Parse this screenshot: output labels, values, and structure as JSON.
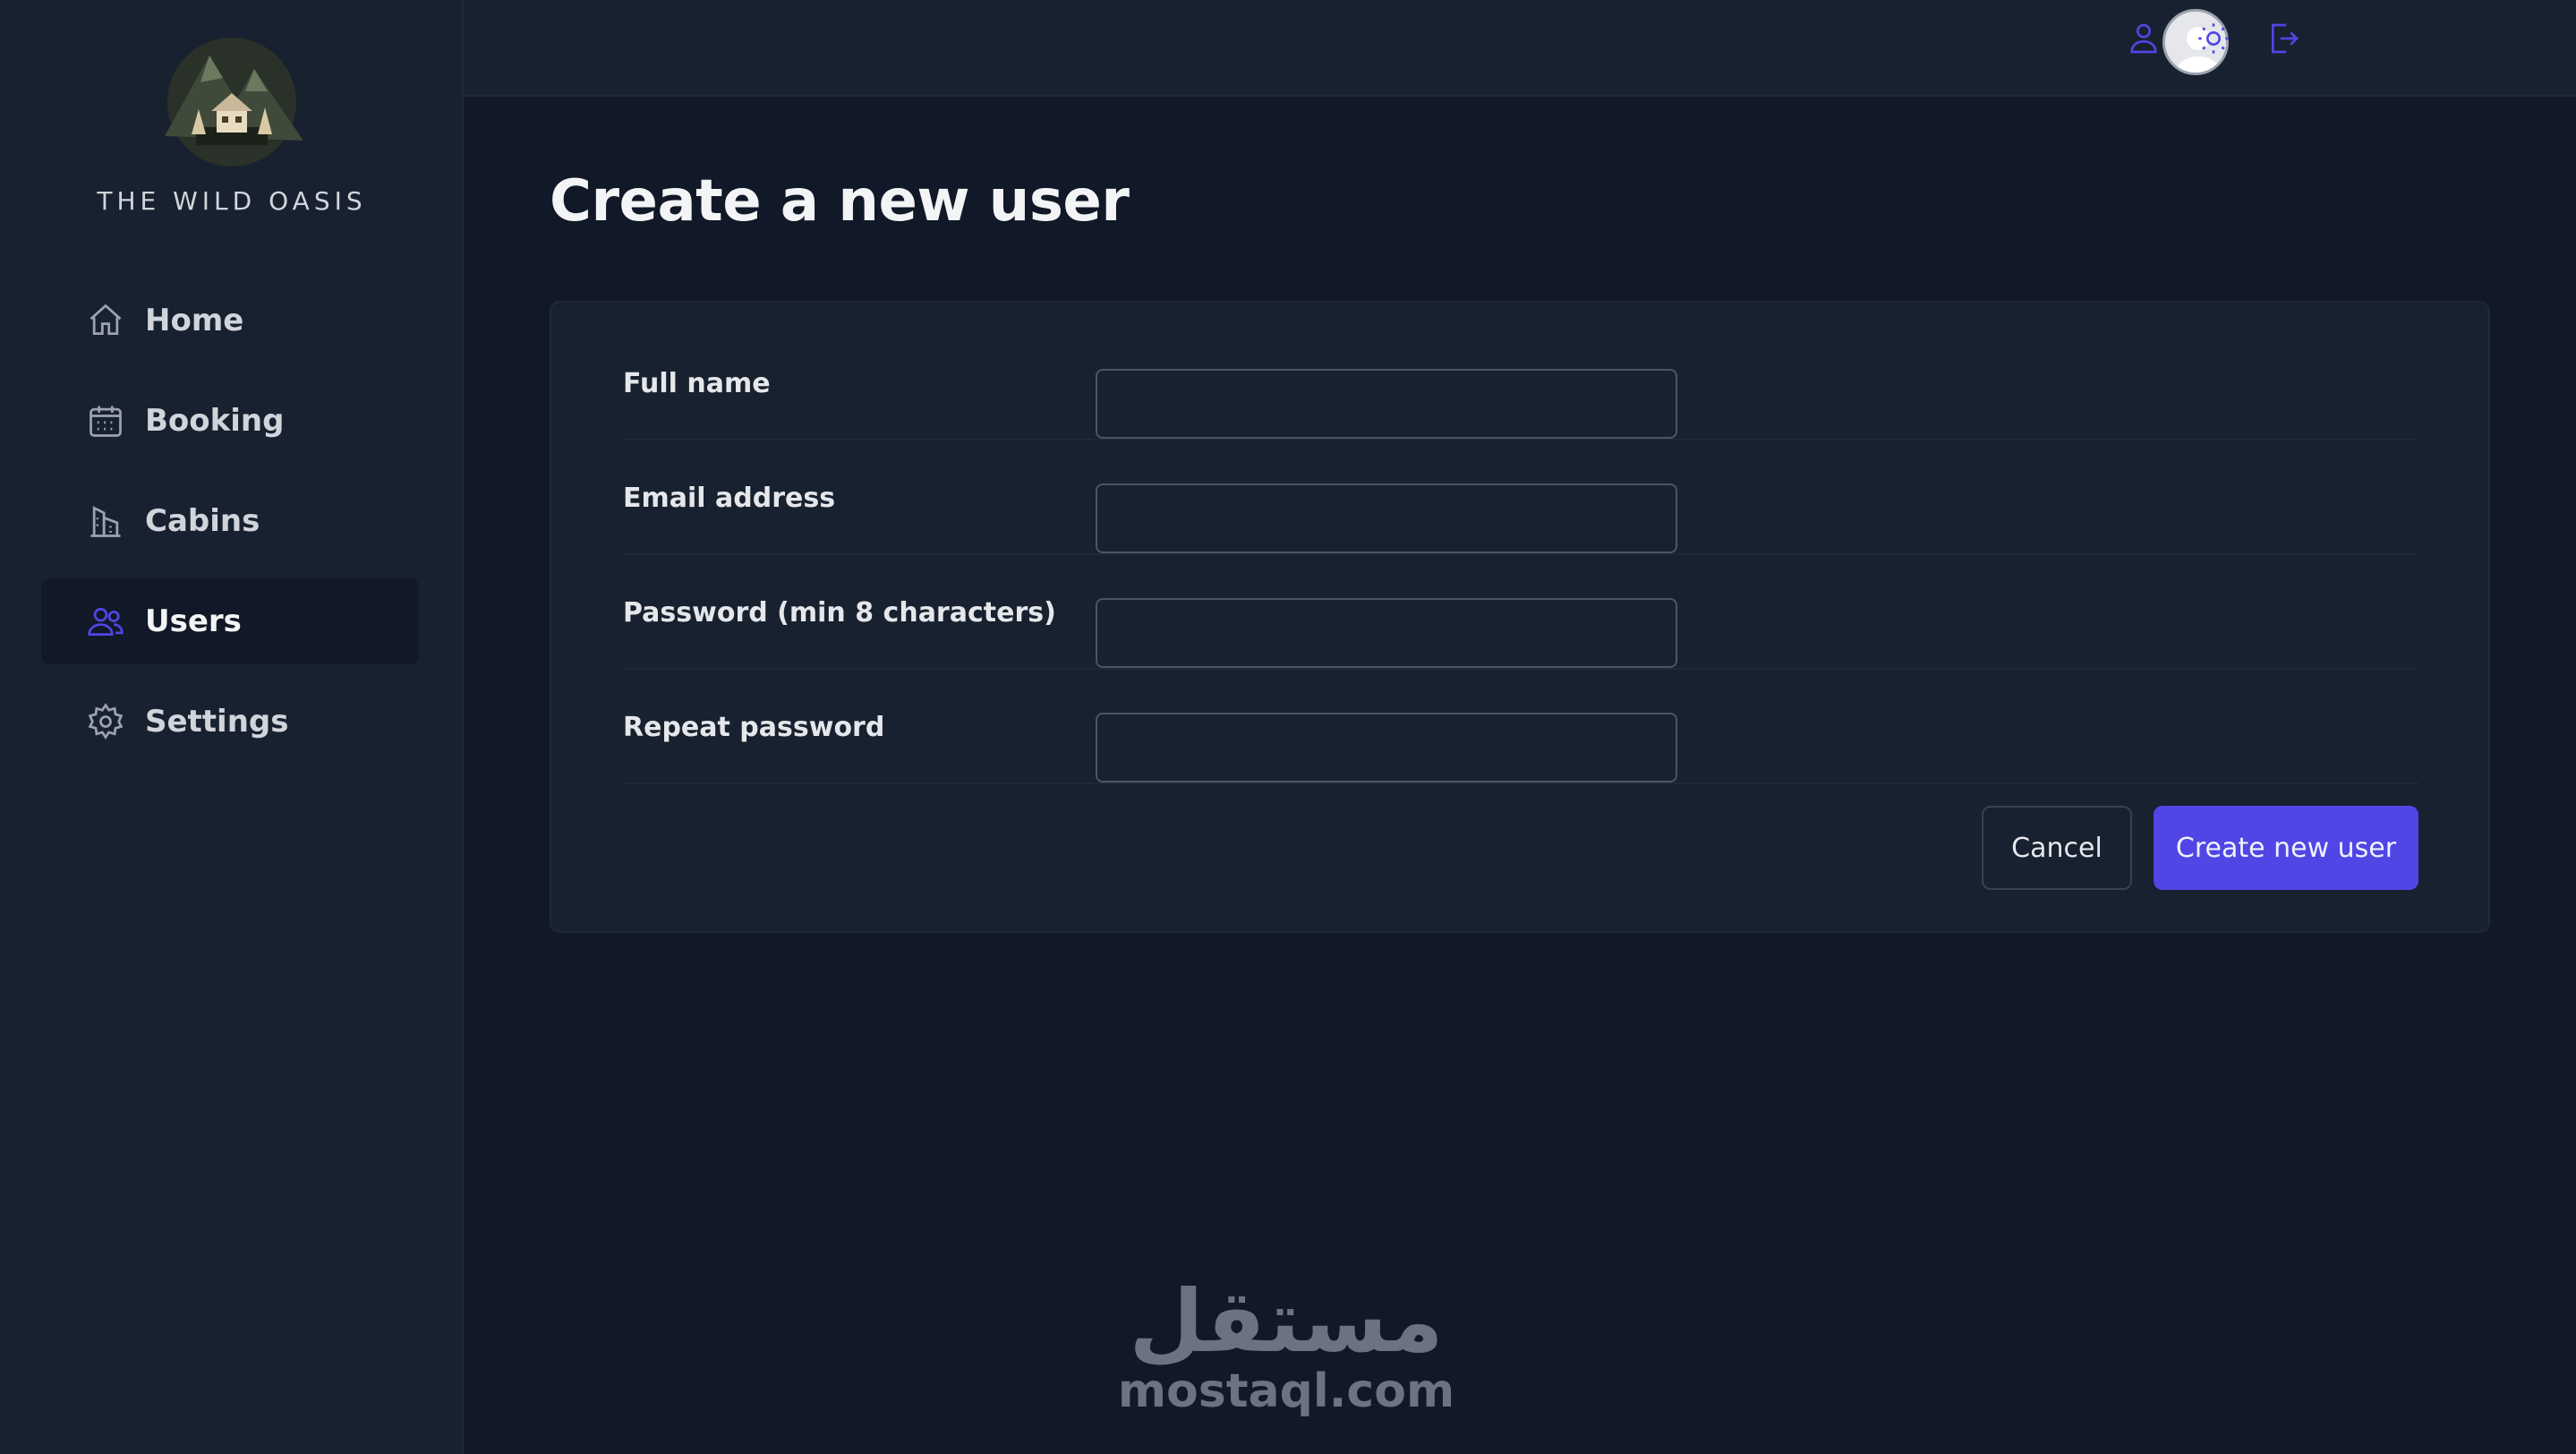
{
  "brand": {
    "name": "THE WILD OASIS"
  },
  "sidebar": {
    "items": [
      {
        "label": "Home",
        "icon": "home-icon"
      },
      {
        "label": "Booking",
        "icon": "calendar-icon"
      },
      {
        "label": "Cabins",
        "icon": "building-icon"
      },
      {
        "label": "Users",
        "icon": "users-icon",
        "active": true
      },
      {
        "label": "Settings",
        "icon": "gear-icon"
      }
    ]
  },
  "header": {
    "icons": [
      "user-icon",
      "sun-icon",
      "logout-icon"
    ]
  },
  "main": {
    "title": "Create a new user",
    "form": {
      "fields": [
        {
          "label": "Full name",
          "value": ""
        },
        {
          "label": "Email address",
          "value": ""
        },
        {
          "label": "Password (min 8 characters)",
          "value": ""
        },
        {
          "label": "Repeat password",
          "value": ""
        }
      ],
      "cancel_label": "Cancel",
      "submit_label": "Create new user"
    }
  },
  "watermark": {
    "arabic": "مستقل",
    "latin": "mostaql.com"
  },
  "colors": {
    "accent": "#4f46e5",
    "background": "#111827",
    "panel": "#18212f"
  }
}
